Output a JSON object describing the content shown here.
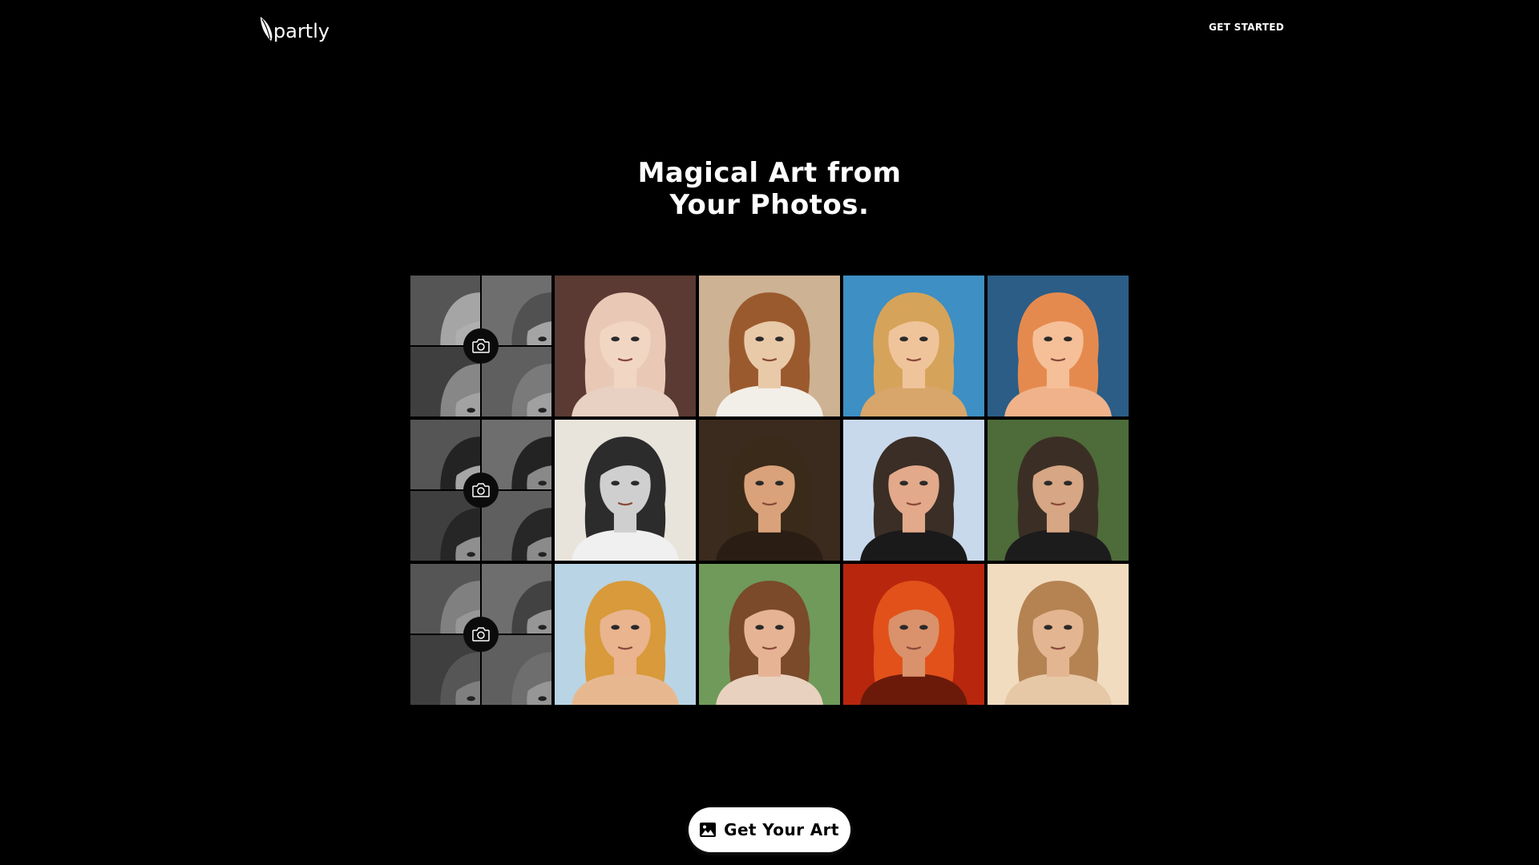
{
  "header": {
    "logo_text": "partly",
    "logo_icon": "leaf-icon",
    "nav_cta_label": "GET STARTED"
  },
  "hero": {
    "title_line1": "Magical Art from",
    "title_line2": "Your Photos."
  },
  "gallery": {
    "source_icon": "camera-icon",
    "rows": [
      {
        "subject": "woman-blonde",
        "portraits": [
          {
            "style": "soft-pink-painted",
            "bg": "#5a3a32",
            "hair": "#e9c9b6",
            "skin": "#f2d6c4",
            "clothing": "#e8d0c3"
          },
          {
            "style": "sepia-sketch",
            "bg": "#cdb294",
            "hair": "#9b5a2e",
            "skin": "#e8c9a8",
            "clothing": "#f2efe8"
          },
          {
            "style": "desert-flower",
            "bg": "#3d8fc4",
            "hair": "#d6a35a",
            "skin": "#f0c49a",
            "clothing": "#d8a66a"
          },
          {
            "style": "cartoon-blue",
            "bg": "#2b5d86",
            "hair": "#e58a4e",
            "skin": "#f5bf98",
            "clothing": "#f0b28a"
          }
        ]
      },
      {
        "subject": "man-short-hair",
        "portraits": [
          {
            "style": "ink-charcoal",
            "bg": "#e8e4dc",
            "hair": "#2c2c2c",
            "skin": "#cfcfcf",
            "clothing": "#f0f0f0"
          },
          {
            "style": "steampunk",
            "bg": "#3b2a1e",
            "hair": "#3a2a1a",
            "skin": "#d9a27a",
            "clothing": "#2a1d14"
          },
          {
            "style": "winter-snow",
            "bg": "#c9d9ec",
            "hair": "#3a2e26",
            "skin": "#e2a98a",
            "clothing": "#1a1a1a"
          },
          {
            "style": "forest-leaves",
            "bg": "#4e6b3a",
            "hair": "#3b2f25",
            "skin": "#d7a684",
            "clothing": "#1c1c1c"
          }
        ]
      },
      {
        "subject": "woman-curly-hair",
        "portraits": [
          {
            "style": "golden-watercolor",
            "bg": "#b9d4e4",
            "hair": "#d89a3a",
            "skin": "#e9b48e",
            "clothing": "#e7b890"
          },
          {
            "style": "floral-green",
            "bg": "#6f9a5a",
            "hair": "#7a4a2a",
            "skin": "#e6b394",
            "clothing": "#e9d1bf"
          },
          {
            "style": "fire",
            "bg": "#b8260e",
            "hair": "#e2511a",
            "skin": "#d9926c",
            "clothing": "#6b1a0a"
          },
          {
            "style": "warm-sepia",
            "bg": "#f1dcc0",
            "hair": "#b58352",
            "skin": "#e3b590",
            "clothing": "#e6c8a6"
          }
        ]
      }
    ]
  },
  "cta": {
    "label": "Get Your Art",
    "icon": "image-icon"
  },
  "colors": {
    "background": "#000000",
    "text": "#ffffff",
    "cta_background": "#ffffff",
    "cta_text": "#000000"
  }
}
